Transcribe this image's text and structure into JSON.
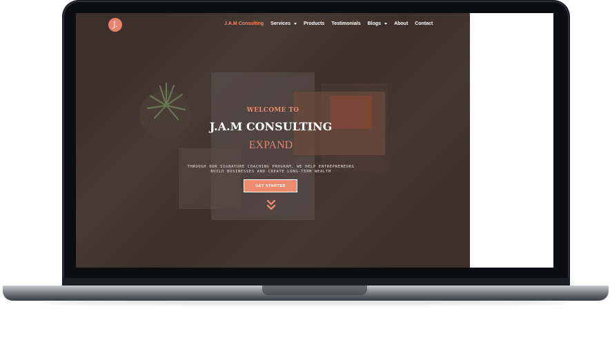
{
  "brand": {
    "logo_text": "J."
  },
  "nav": {
    "items": [
      {
        "label": "J.A.M Consulting",
        "active": true,
        "dropdown": false
      },
      {
        "label": "Services",
        "active": false,
        "dropdown": true
      },
      {
        "label": "Products",
        "active": false,
        "dropdown": false
      },
      {
        "label": "Testimonials",
        "active": false,
        "dropdown": false
      },
      {
        "label": "Blogs",
        "active": false,
        "dropdown": true
      },
      {
        "label": "About",
        "active": false,
        "dropdown": false
      },
      {
        "label": "Contact",
        "active": false,
        "dropdown": false
      }
    ]
  },
  "hero": {
    "welcome": "WELCOME TO",
    "title": "J.A.M CONSULTING",
    "rotating_word": "EXPAND",
    "tagline_line1": "THROUGH OUR SIGNATURE COACHING PROGRAM, WE HELP ENTREPRENEURS",
    "tagline_line2": "BUILD BUSINESSES AND CREATE LONG-TERM WEALTH",
    "cta_label": "GET STARTED",
    "scroll_icon": "double-chevron-down-icon"
  },
  "colors": {
    "accent": "#ee8a6e",
    "background": "#3d302b",
    "text": "#ffffff"
  }
}
